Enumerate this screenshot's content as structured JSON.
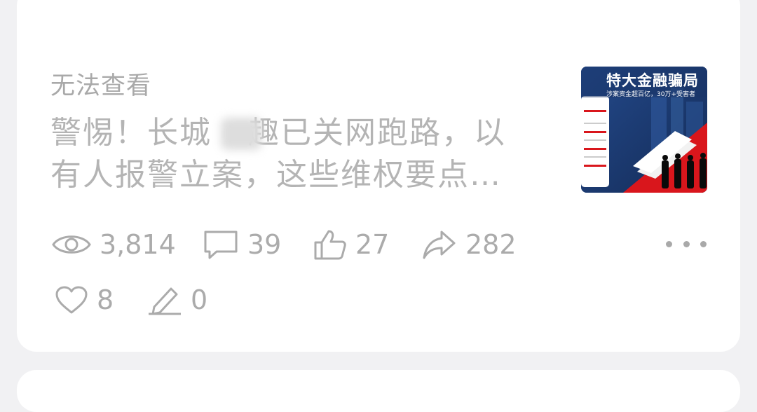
{
  "status_label": "无法查看",
  "article": {
    "title_line1": "警惕！长城",
    "title_line1_rest": "趣已关网跑路，以",
    "title_line2": "有人报警立案，这些维权要点…"
  },
  "thumbnail": {
    "headline": "特大金融骗局",
    "subline": "涉案资金超百亿，30万+受害者"
  },
  "stats": {
    "views": "3,814",
    "comments": "39",
    "likes": "27",
    "shares": "282",
    "favorites": "8",
    "edits": "0"
  },
  "colors": {
    "muted_text": "#b4b4b4",
    "icon": "#ababab",
    "thumb_red": "#d9161c",
    "thumb_blue": "#1e3f7a"
  }
}
